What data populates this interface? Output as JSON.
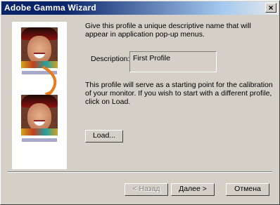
{
  "window": {
    "title": "Adobe Gamma Wizard",
    "close_glyph": "×"
  },
  "intro_text": "Give this profile a unique descriptive name that will appear in application pop-up menus.",
  "description": {
    "label": "Description:",
    "value": "First Profile"
  },
  "explain_text": "This profile will serve as a starting point for the calibration of your monitor. If you wish to start with a different profile, click on Load.",
  "buttons": {
    "load": "Load...",
    "back": "< Назад",
    "next": "Далее >",
    "cancel": "Отмена"
  },
  "colors": {
    "title_active": "#0a246a",
    "arrow": "#e87a1a",
    "dialog_bg": "#d4d0c8"
  },
  "icons": [
    "close-icon",
    "arrow-icon"
  ]
}
